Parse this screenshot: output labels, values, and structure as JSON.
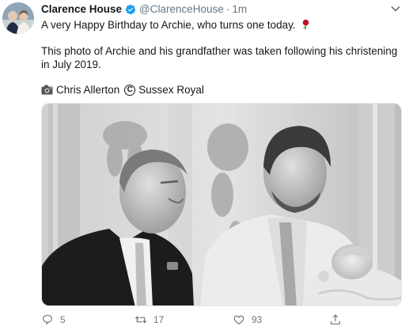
{
  "tweet": {
    "author_name": "Clarence House",
    "handle": "@ClarenceHouse",
    "separator": "·",
    "time": "1m",
    "text_line1": "A very Happy Birthday to Archie, who turns one today.",
    "emoji": "rose-emoji",
    "text_line2": "This photo of Archie and his grandfather was taken following his christening",
    "text_line3": "in July 2019.",
    "credit_name": "Chris Allerton",
    "copyright_symbol": "C",
    "credit_org": "Sussex Royal"
  },
  "actions": {
    "replies": "5",
    "retweets": "17",
    "likes": "93"
  },
  "colors": {
    "verified": "#1da1f2",
    "secondary_text": "#657786",
    "rose": "#c0142c"
  }
}
